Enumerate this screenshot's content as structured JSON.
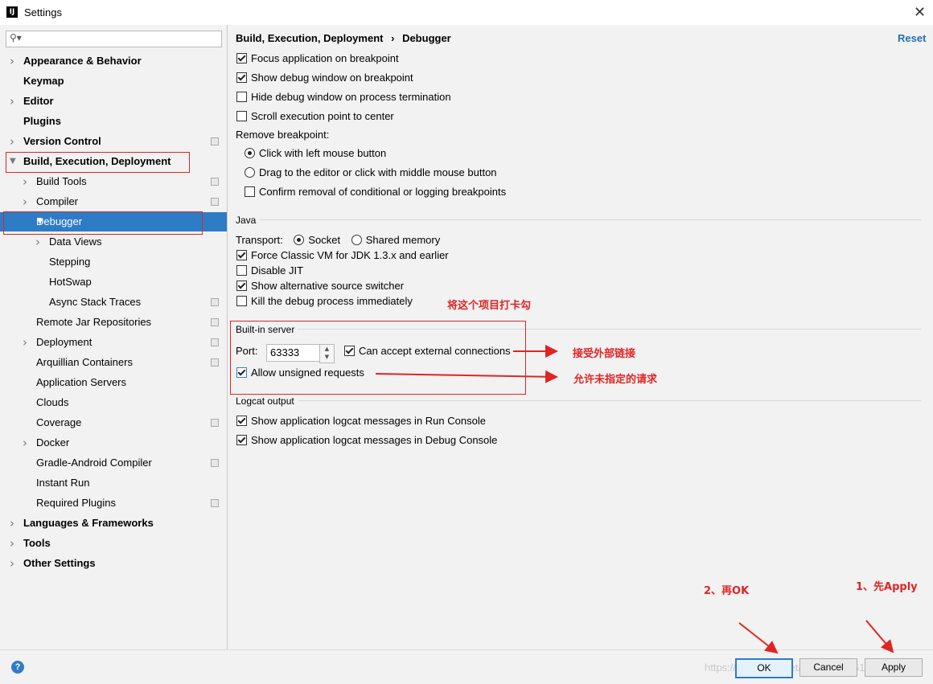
{
  "window": {
    "title": "Settings",
    "app_icon": "IJ"
  },
  "search": {
    "placeholder": ""
  },
  "tree": [
    {
      "label": "Appearance & Behavior",
      "bold": true,
      "arrow": "right",
      "indent": 0
    },
    {
      "label": "Keymap",
      "bold": true,
      "arrow": "",
      "indent": 0
    },
    {
      "label": "Editor",
      "bold": true,
      "arrow": "right",
      "indent": 0
    },
    {
      "label": "Plugins",
      "bold": true,
      "arrow": "",
      "indent": 0
    },
    {
      "label": "Version Control",
      "bold": true,
      "arrow": "right",
      "indent": 0,
      "proj": true
    },
    {
      "label": "Build, Execution, Deployment",
      "bold": true,
      "arrow": "down",
      "indent": 0
    },
    {
      "label": "Build Tools",
      "bold": false,
      "arrow": "right",
      "indent": 1,
      "proj": true
    },
    {
      "label": "Compiler",
      "bold": false,
      "arrow": "right",
      "indent": 1,
      "proj": true
    },
    {
      "label": "Debugger",
      "bold": false,
      "arrow": "down",
      "indent": 1,
      "selected": true
    },
    {
      "label": "Data Views",
      "bold": false,
      "arrow": "right",
      "indent": 2
    },
    {
      "label": "Stepping",
      "bold": false,
      "arrow": "",
      "indent": 2
    },
    {
      "label": "HotSwap",
      "bold": false,
      "arrow": "",
      "indent": 2
    },
    {
      "label": "Async Stack Traces",
      "bold": false,
      "arrow": "",
      "indent": 2,
      "proj": true
    },
    {
      "label": "Remote Jar Repositories",
      "bold": false,
      "arrow": "",
      "indent": 1,
      "proj": true
    },
    {
      "label": "Deployment",
      "bold": false,
      "arrow": "right",
      "indent": 1,
      "proj": true
    },
    {
      "label": "Arquillian Containers",
      "bold": false,
      "arrow": "",
      "indent": 1,
      "proj": true
    },
    {
      "label": "Application Servers",
      "bold": false,
      "arrow": "",
      "indent": 1
    },
    {
      "label": "Clouds",
      "bold": false,
      "arrow": "",
      "indent": 1
    },
    {
      "label": "Coverage",
      "bold": false,
      "arrow": "",
      "indent": 1,
      "proj": true
    },
    {
      "label": "Docker",
      "bold": false,
      "arrow": "right",
      "indent": 1
    },
    {
      "label": "Gradle-Android Compiler",
      "bold": false,
      "arrow": "",
      "indent": 1,
      "proj": true
    },
    {
      "label": "Instant Run",
      "bold": false,
      "arrow": "",
      "indent": 1
    },
    {
      "label": "Required Plugins",
      "bold": false,
      "arrow": "",
      "indent": 1,
      "proj": true
    },
    {
      "label": "Languages & Frameworks",
      "bold": true,
      "arrow": "right",
      "indent": 0
    },
    {
      "label": "Tools",
      "bold": true,
      "arrow": "right",
      "indent": 0
    },
    {
      "label": "Other Settings",
      "bold": true,
      "arrow": "right",
      "indent": 0
    }
  ],
  "main": {
    "breadcrumb_parent": "Build, Execution, Deployment",
    "breadcrumb_sep": "›",
    "breadcrumb_current": "Debugger",
    "reset": "Reset",
    "general": {
      "focus_app": {
        "label": "Focus application on breakpoint",
        "checked": true
      },
      "show_debug_window": {
        "label": "Show debug window on breakpoint",
        "checked": true
      },
      "hide_debug_window": {
        "label": "Hide debug window on process termination",
        "checked": false
      },
      "scroll_center": {
        "label": "Scroll execution point to center",
        "checked": false
      },
      "remove_breakpoint_label": "Remove breakpoint:",
      "click_left": {
        "label": "Click with left mouse button",
        "checked": true
      },
      "drag_middle": {
        "label": "Drag to the editor or click with middle mouse button",
        "checked": false
      },
      "confirm_removal": {
        "label": "Confirm removal of conditional or logging breakpoints",
        "checked": false
      }
    },
    "java": {
      "title": "Java",
      "transport_label": "Transport:",
      "socket": {
        "label": "Socket",
        "checked": true
      },
      "shared_memory": {
        "label": "Shared memory",
        "checked": false
      },
      "force_classic": {
        "label": "Force Classic VM for JDK 1.3.x and earlier",
        "checked": true
      },
      "disable_jit": {
        "label": "Disable JIT",
        "checked": false
      },
      "alt_source": {
        "label": "Show alternative source switcher",
        "checked": true
      },
      "kill_process": {
        "label": "Kill the debug process immediately",
        "checked": false
      }
    },
    "server": {
      "title": "Built-in server",
      "port_label": "Port:",
      "port_value": "63333",
      "accept_external": {
        "label": "Can accept external connections",
        "checked": true
      },
      "allow_unsigned": {
        "label": "Allow unsigned requests",
        "checked": true
      }
    },
    "logcat": {
      "title": "Logcat output",
      "run_console": {
        "label": "Show application logcat messages in Run Console",
        "checked": true
      },
      "debug_console": {
        "label": "Show application logcat messages in Debug Console",
        "checked": true
      }
    }
  },
  "annotations": {
    "tick_this": "将这个项目打卡勾",
    "accept_external": "接受外部链接",
    "allow_unsigned": "允许未指定的请求",
    "then_ok": "2、再OK",
    "first_apply": "1、先Apply"
  },
  "buttons": {
    "ok": "OK",
    "cancel": "Cancel",
    "apply": "Apply",
    "help": "?"
  },
  "watermark": "https://blog.csdn.net/weixin_44251027",
  "colors": {
    "selection": "#2f7cc6",
    "annotation": "#e02424",
    "link": "#2470b3"
  }
}
